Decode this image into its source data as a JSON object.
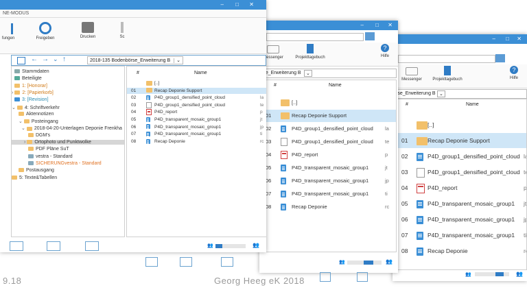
{
  "window1": {
    "app_title": "NE-MODUS",
    "ribbon": [
      {
        "label": "fungen"
      },
      {
        "label": "Freigeben"
      },
      {
        "label": "Drucken"
      },
      {
        "label": "Sc"
      },
      {
        "label": "Messenger"
      },
      {
        "label": "Projekttagebuch"
      },
      {
        "label": "Hilfe"
      }
    ],
    "path": "2018-135 Bodenbörse_Erweiterung B",
    "tree": [
      {
        "label": "Stammdaten",
        "color": "#333"
      },
      {
        "label": "Beteiligte",
        "color": "#333"
      },
      {
        "label": "1: [Honorar]",
        "color": "#d07a17"
      },
      {
        "label": "2: [Papierkorb]",
        "color": "#d07a17"
      },
      {
        "label": "3: [Revision]",
        "color": "#2a8bb0"
      },
      {
        "label": "4: Schriftverkehr",
        "color": "#333"
      },
      {
        "label": "Aktennotizen",
        "color": "#333"
      },
      {
        "label": "Posteingang",
        "color": "#333"
      },
      {
        "label": "2018-04-20-Unterlagen Deponie Frenkha",
        "color": "#333"
      },
      {
        "label": "DGM's",
        "color": "#333"
      },
      {
        "label": "Ortophoto und Punktwolke",
        "color": "#333"
      },
      {
        "label": "PDF Pläne SuT",
        "color": "#333"
      },
      {
        "label": "vestra - Standard",
        "color": "#333"
      },
      {
        "label": "SICHERUNGvestra - Standard",
        "color": "#e07020"
      },
      {
        "label": "Postausgang",
        "color": "#333"
      },
      {
        "label": "5: Texte&Tabellen",
        "color": "#333"
      }
    ],
    "col_num": "#",
    "col_name": "Name",
    "files": [
      {
        "num": "",
        "name": "[..]",
        "type": "folder",
        "extra": ""
      },
      {
        "num": "01",
        "name": "Recap Deponie Support",
        "type": "folder",
        "extra": ""
      },
      {
        "num": "02",
        "name": "P4D_group1_densified_point_cloud",
        "type": "doc",
        "extra": "la"
      },
      {
        "num": "03",
        "name": "P4D_group1_densified_point_cloud",
        "type": "txt",
        "extra": "te"
      },
      {
        "num": "04",
        "name": "P4D_report",
        "type": "pdf",
        "extra": "p"
      },
      {
        "num": "05",
        "name": "P4D_transparent_mosaic_group1",
        "type": "doc",
        "extra": "jt"
      },
      {
        "num": "06",
        "name": "P4D_transparent_mosaic_group1",
        "type": "doc",
        "extra": "jp"
      },
      {
        "num": "07",
        "name": "P4D_transparent_mosaic_group1",
        "type": "doc",
        "extra": "ti"
      },
      {
        "num": "08",
        "name": "Recap Deponie",
        "type": "doc",
        "extra": "rc"
      }
    ]
  },
  "window2": {
    "ribbon": [
      {
        "label": "Messenger"
      },
      {
        "label": "Projekttagebuch"
      },
      {
        "label": "Hilfe"
      }
    ],
    "path": "rse_Erweiterung B",
    "col_num": "#",
    "col_name": "Name"
  },
  "window3": {
    "ribbon": [
      {
        "label": "Messenger"
      },
      {
        "label": "Projekttagebuch"
      },
      {
        "label": "Hilfe"
      }
    ],
    "path": "rse_Erweiterung B",
    "col_num": "#",
    "col_name": "Name"
  },
  "footer": {
    "left": "9.18",
    "center": "Georg Heeg eK 2018"
  }
}
